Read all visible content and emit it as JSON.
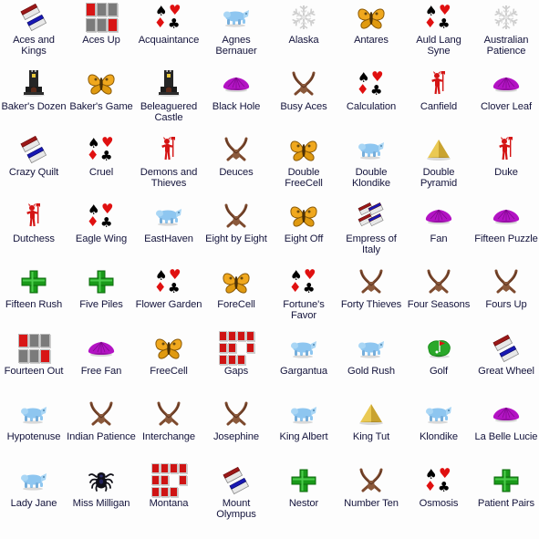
{
  "app": {
    "title": "Solitaire Game Chooser",
    "columns": 8,
    "background_color": "#fdfdfd",
    "label_color": "#14143c"
  },
  "icon_palette": {
    "card_red": "#d81616",
    "card_gray": "#7b7b7b",
    "butterfly_orange": "#f0a81e",
    "bear_blue": "#8ec6f0",
    "fan_purple": "#b313c4",
    "cross_green": "#1a9a1a",
    "pyramid_gold": "#e0bc44",
    "antlers_brown": "#8b5a3c",
    "devil_red": "#d41414",
    "snowflake_gray": "#d8d8d8",
    "castle_dark": "#2a2a2a",
    "golf_green": "#2aa82a",
    "spider_black": "#101018",
    "suit_black": "#000000",
    "suit_red": "#e01010"
  },
  "items": [
    {
      "label": "Aces and Kings",
      "icon": "two-cards-icon"
    },
    {
      "label": "Aces Up",
      "icon": "card-grid-icon"
    },
    {
      "label": "Acquaintance",
      "icon": "four-suits-icon"
    },
    {
      "label": "Agnes Bernauer",
      "icon": "blue-bear-icon"
    },
    {
      "label": "Alaska",
      "icon": "snowflake-icon"
    },
    {
      "label": "Antares",
      "icon": "butterfly-icon"
    },
    {
      "label": "Auld Lang Syne",
      "icon": "four-suits-icon"
    },
    {
      "label": "Australian Patience",
      "icon": "snowflake-icon"
    },
    {
      "label": "Baker's Dozen",
      "icon": "castle-icon"
    },
    {
      "label": "Baker's Game",
      "icon": "butterfly-icon"
    },
    {
      "label": "Beleaguered Castle",
      "icon": "castle-icon"
    },
    {
      "label": "Black Hole",
      "icon": "purple-fan-icon"
    },
    {
      "label": "Busy Aces",
      "icon": "crossed-antlers-icon"
    },
    {
      "label": "Calculation",
      "icon": "four-suits-icon"
    },
    {
      "label": "Canfield",
      "icon": "red-devil-icon"
    },
    {
      "label": "Clover Leaf",
      "icon": "purple-fan-icon"
    },
    {
      "label": "Crazy Quilt",
      "icon": "two-cards-icon"
    },
    {
      "label": "Cruel",
      "icon": "four-suits-icon"
    },
    {
      "label": "Demons and Thieves",
      "icon": "red-devil-icon"
    },
    {
      "label": "Deuces",
      "icon": "crossed-antlers-icon"
    },
    {
      "label": "Double FreeCell",
      "icon": "butterfly-icon"
    },
    {
      "label": "Double Klondike",
      "icon": "blue-bear-icon"
    },
    {
      "label": "Double Pyramid",
      "icon": "pyramid-icon"
    },
    {
      "label": "Duke",
      "icon": "red-devil-icon"
    },
    {
      "label": "Dutchess",
      "icon": "red-devil-icon"
    },
    {
      "label": "Eagle Wing",
      "icon": "four-suits-icon"
    },
    {
      "label": "EastHaven",
      "icon": "blue-bear-icon"
    },
    {
      "label": "Eight by Eight",
      "icon": "crossed-antlers-icon"
    },
    {
      "label": "Eight Off",
      "icon": "butterfly-icon"
    },
    {
      "label": "Empress of Italy",
      "icon": "four-cards-icon"
    },
    {
      "label": "Fan",
      "icon": "purple-fan-icon"
    },
    {
      "label": "Fifteen Puzzle",
      "icon": "purple-fan-icon"
    },
    {
      "label": "Fifteen Rush",
      "icon": "green-cross-icon"
    },
    {
      "label": "Five Piles",
      "icon": "green-cross-icon"
    },
    {
      "label": "Flower Garden",
      "icon": "four-suits-icon"
    },
    {
      "label": "ForeCell",
      "icon": "butterfly-icon"
    },
    {
      "label": "Fortune's Favor",
      "icon": "four-suits-icon"
    },
    {
      "label": "Forty Thieves",
      "icon": "crossed-antlers-icon"
    },
    {
      "label": "Four Seasons",
      "icon": "crossed-antlers-icon"
    },
    {
      "label": "Fours Up",
      "icon": "crossed-antlers-icon"
    },
    {
      "label": "Fourteen Out",
      "icon": "card-grid-icon"
    },
    {
      "label": "Free Fan",
      "icon": "purple-fan-icon"
    },
    {
      "label": "FreeCell",
      "icon": "butterfly-icon"
    },
    {
      "label": "Gaps",
      "icon": "gaps-grid-icon"
    },
    {
      "label": "Gargantua",
      "icon": "blue-bear-icon"
    },
    {
      "label": "Gold Rush",
      "icon": "blue-bear-icon"
    },
    {
      "label": "Golf",
      "icon": "golf-green-icon"
    },
    {
      "label": "Great Wheel",
      "icon": "two-cards-icon"
    },
    {
      "label": "Hypotenuse",
      "icon": "blue-bear-icon"
    },
    {
      "label": "Indian Patience",
      "icon": "crossed-antlers-icon"
    },
    {
      "label": "Interchange",
      "icon": "crossed-antlers-icon"
    },
    {
      "label": "Josephine",
      "icon": "crossed-antlers-icon"
    },
    {
      "label": "King Albert",
      "icon": "blue-bear-icon"
    },
    {
      "label": "King Tut",
      "icon": "pyramid-icon"
    },
    {
      "label": "Klondike",
      "icon": "blue-bear-icon"
    },
    {
      "label": "La Belle Lucie",
      "icon": "purple-fan-icon"
    },
    {
      "label": "Lady Jane",
      "icon": "blue-bear-icon"
    },
    {
      "label": "Miss Milligan",
      "icon": "spider-icon"
    },
    {
      "label": "Montana",
      "icon": "gaps-grid-icon"
    },
    {
      "label": "Mount Olympus",
      "icon": "two-cards-icon"
    },
    {
      "label": "Nestor",
      "icon": "green-cross-icon"
    },
    {
      "label": "Number Ten",
      "icon": "crossed-antlers-icon"
    },
    {
      "label": "Osmosis",
      "icon": "four-suits-icon"
    },
    {
      "label": "Patient Pairs",
      "icon": "green-cross-icon"
    }
  ]
}
